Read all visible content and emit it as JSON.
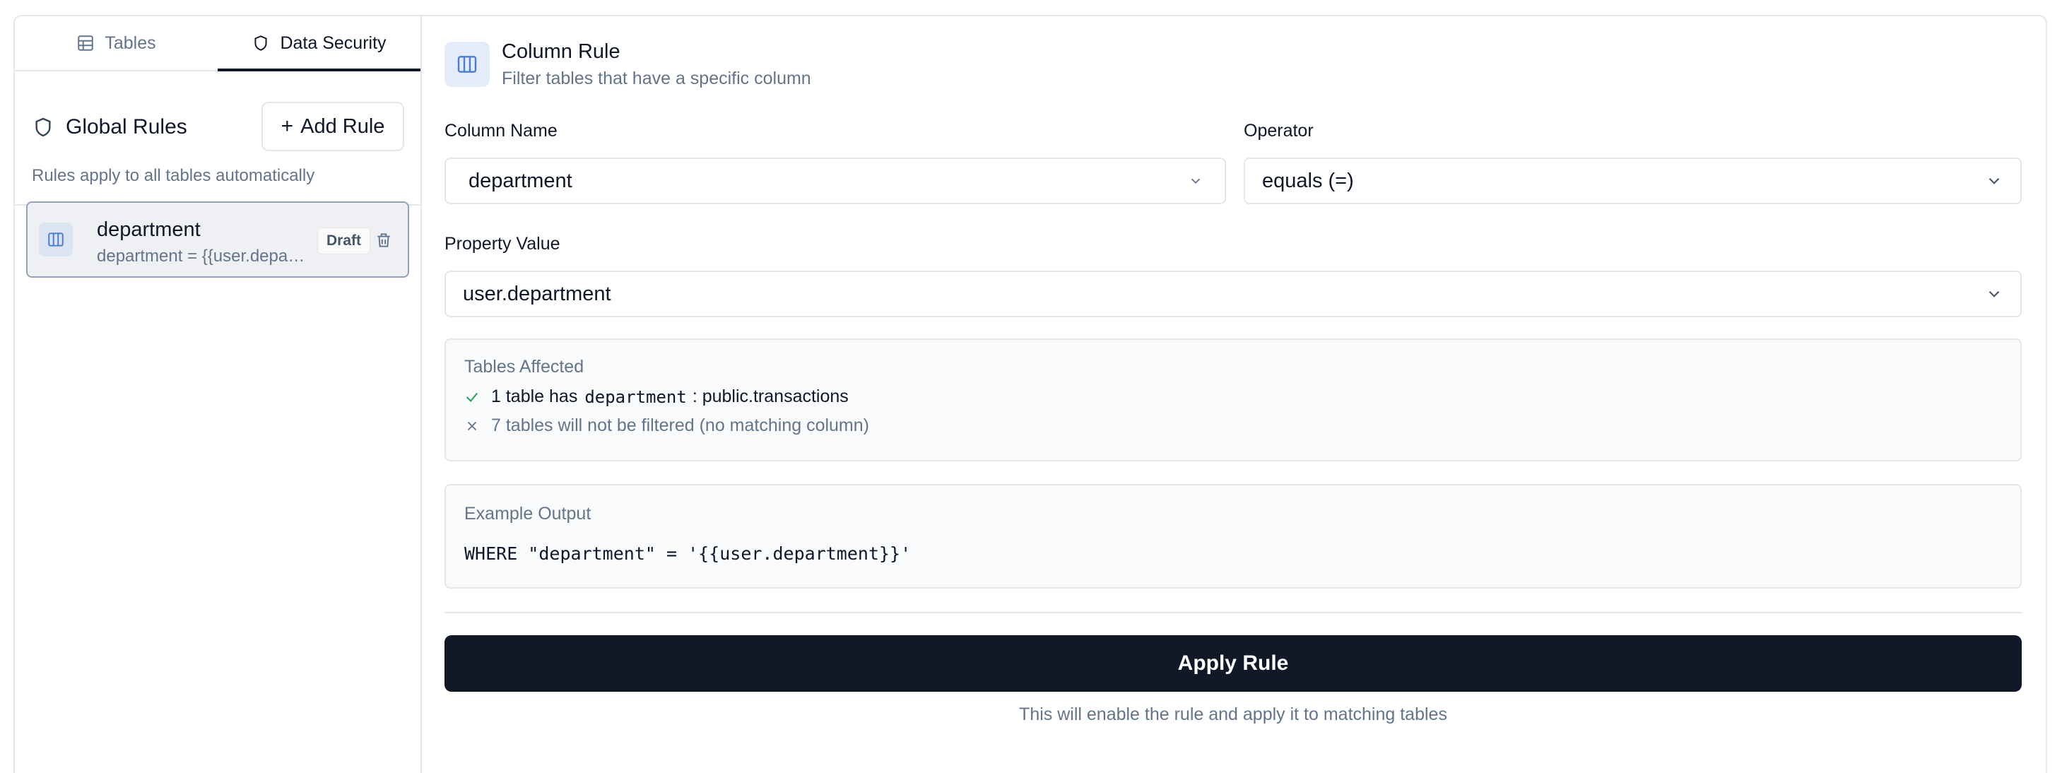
{
  "tabs": [
    {
      "label": "Tables",
      "icon": "table-icon",
      "active": false
    },
    {
      "label": "Data Security",
      "icon": "shield-icon",
      "active": true
    }
  ],
  "global_rules": {
    "title": "Global Rules",
    "add_label": "Add Rule",
    "subtitle": "Rules apply to all tables automatically"
  },
  "rules": [
    {
      "name": "department",
      "description": "department = {{user.department}}",
      "badge": "Draft",
      "icon": "columns-icon"
    }
  ],
  "rule_header": {
    "title": "Column Rule",
    "subtitle": "Filter tables that have a specific column",
    "icon": "columns-icon"
  },
  "form": {
    "column_name_label": "Column Name",
    "column_name_value": "department",
    "operator_label": "Operator",
    "operator_value": "equals (=)",
    "property_value_label": "Property Value",
    "property_value_value": "user.department"
  },
  "tables_affected": {
    "title": "Tables Affected",
    "match_prefix": "1 table has",
    "match_column": "department",
    "match_suffix": ": public.transactions",
    "nomatch_text": "7 tables will not be filtered (no matching column)"
  },
  "example_output": {
    "title": "Example Output",
    "code": "WHERE \"department\" = '{{user.department}}'"
  },
  "apply": {
    "label": "Apply Rule",
    "note": "This will enable the rule and apply it to matching tables"
  },
  "colors": {
    "accent_dark": "#111827",
    "icon_blue": "#4a7cd6",
    "check_green": "#22a35a",
    "muted": "#64748b"
  }
}
